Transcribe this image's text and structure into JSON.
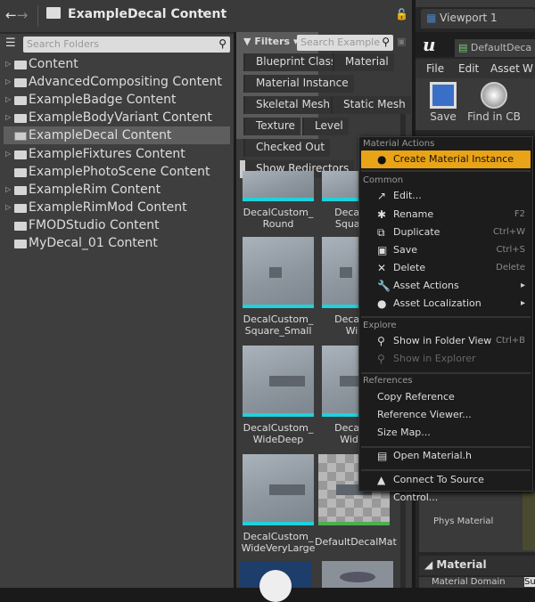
{
  "toolbar": {
    "back": "←",
    "forward": "→",
    "path": "ExampleDecal Content",
    "path_arrow": "▸",
    "lock": "🔓"
  },
  "folders": {
    "search_placeholder": "Search Folders",
    "items": [
      {
        "label": "Content",
        "expandable": true
      },
      {
        "label": "AdvancedCompositing Content",
        "expandable": true
      },
      {
        "label": "ExampleBadge Content",
        "expandable": true
      },
      {
        "label": "ExampleBodyVariant Content",
        "expandable": true
      },
      {
        "label": "ExampleDecal Content",
        "expandable": false,
        "selected": true
      },
      {
        "label": "ExampleFixtures Content",
        "expandable": true
      },
      {
        "label": "ExamplePhotoScene Content",
        "expandable": false
      },
      {
        "label": "ExampleRim Content",
        "expandable": true
      },
      {
        "label": "ExampleRimMod Content",
        "expandable": true
      },
      {
        "label": "FMODStudio Content",
        "expandable": false
      },
      {
        "label": "MyDecal_01 Content",
        "expandable": false
      }
    ]
  },
  "assets": {
    "filters_label": "Filters ▾",
    "search_placeholder": "Search Example",
    "filter_chips": [
      "Blueprint Class",
      "Material",
      "Material Instance",
      "Skeletal Mesh",
      "Static Mesh",
      "Texture",
      "Level",
      "Checked Out",
      "Show Redirectors"
    ],
    "tiles": [
      {
        "line1": "DecalCustom_",
        "line2": "Round"
      },
      {
        "line1": "DecalCu",
        "line2": "Square_"
      },
      {
        "line1": "DecalCustom_",
        "line2": "Square_Small"
      },
      {
        "line1": "DecalCu",
        "line2": "Wid"
      },
      {
        "line1": "DecalCustom_",
        "line2": "WideDeep"
      },
      {
        "line1": "DecalCu",
        "line2": "WideL"
      },
      {
        "line1": "DecalCustom_",
        "line2": "WideVeryLarge"
      },
      {
        "line1": "DefaultDecalMat",
        "line2": ""
      }
    ]
  },
  "editor": {
    "tab": "Viewport 1",
    "asset_tab": "DefaultDeca",
    "menus": [
      "File",
      "Edit",
      "Asset",
      "W"
    ],
    "save": "Save",
    "find": "Find in CB",
    "phys_material": "Phys Material",
    "section": "Material",
    "material_domain": "Material Domain",
    "domain_value": "Su"
  },
  "context_menu": {
    "sections": {
      "material_actions": "Material Actions",
      "common": "Common",
      "explore": "Explore",
      "references": "References"
    },
    "create_instance": "Create Material Instance",
    "edit": "Edit...",
    "rename": "Rename",
    "rename_sc": "F2",
    "duplicate": "Duplicate",
    "duplicate_sc": "Ctrl+W",
    "save": "Save",
    "save_sc": "Ctrl+S",
    "delete": "Delete",
    "delete_sc": "Delete",
    "asset_actions": "Asset Actions",
    "asset_localization": "Asset Localization",
    "submenu_arrow": "▸",
    "show_folder": "Show in Folder View",
    "show_folder_sc": "Ctrl+B",
    "show_explorer": "Show in Explorer",
    "copy_ref": "Copy Reference",
    "ref_viewer": "Reference Viewer...",
    "size_map": "Size Map...",
    "open_h": "Open Material.h",
    "connect_sc": "Connect To Source Control..."
  },
  "colors": {
    "highlight": "#e9a316",
    "accent_cyan": "#1fd1dc"
  }
}
